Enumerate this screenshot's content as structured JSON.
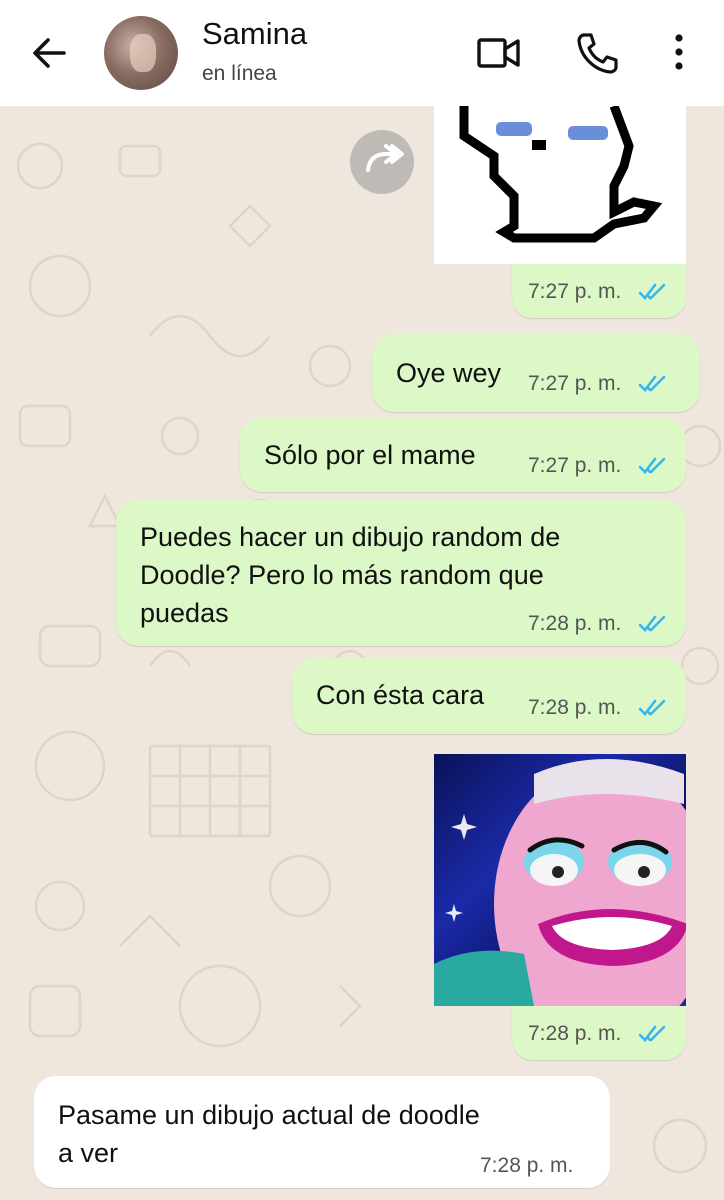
{
  "header": {
    "contact_name": "Samina",
    "status": "en línea"
  },
  "icons": {
    "back": "arrow-left-icon",
    "video": "video-camera-icon",
    "call": "phone-icon",
    "menu": "more-vertical-icon",
    "forward": "forward-icon",
    "read": "double-check-icon"
  },
  "colors": {
    "outgoing_bubble": "#dcf8c6",
    "incoming_bubble": "#ffffff",
    "read_ticks": "#34b7f1",
    "chat_background": "#efe7dd"
  },
  "messages": [
    {
      "type": "image",
      "from": "me",
      "time": "7:27 p. m.",
      "read": true
    },
    {
      "type": "text",
      "from": "me",
      "text": "Oye wey",
      "time": "7:27 p. m.",
      "read": true
    },
    {
      "type": "text",
      "from": "me",
      "text": "Sólo por el mame",
      "time": "7:27 p. m.",
      "read": true
    },
    {
      "type": "text",
      "from": "me",
      "lines": [
        "Puedes hacer un dibujo random de",
        "Doodle? Pero lo más random que",
        "puedas"
      ],
      "time": "7:28 p. m.",
      "read": true
    },
    {
      "type": "text",
      "from": "me",
      "text": "Con ésta cara",
      "time": "7:28 p. m.",
      "read": true
    },
    {
      "type": "image",
      "from": "me",
      "time": "7:28 p. m.",
      "read": true
    },
    {
      "type": "text",
      "from": "contact",
      "lines": [
        "Pasame un dibujo actual de doodle",
        "a ver"
      ],
      "time": "7:28 p. m."
    }
  ]
}
